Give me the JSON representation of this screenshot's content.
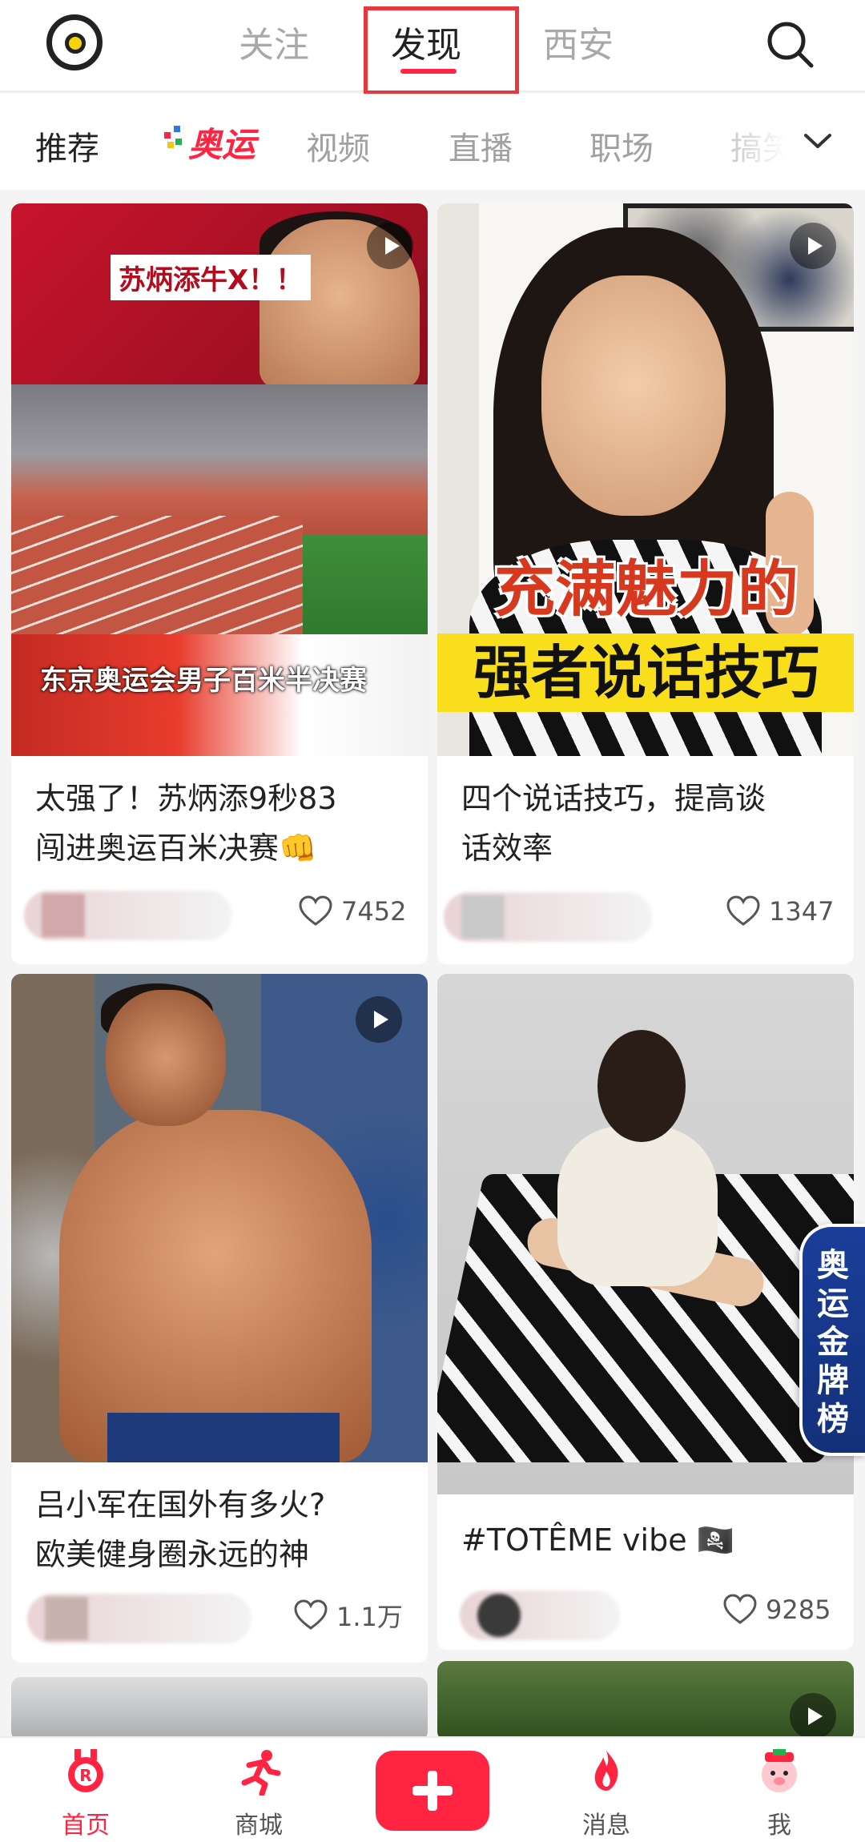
{
  "top_tabs": [
    "关注",
    "发现",
    "西安"
  ],
  "active_top_tab": "发现",
  "categories": {
    "recommend": "推荐",
    "olympic": "奥运",
    "video": "视频",
    "live": "直播",
    "workplace": "职场",
    "funny": "搞笑"
  },
  "feed": [
    {
      "title_line1": "太强了！苏炳添9秒83",
      "title_line2": "闯进奥运百米决赛👊",
      "likes": "7452",
      "thumb_banner": "苏炳添牛X！！",
      "thumb_caption": "东京奥运会男子百米半决赛",
      "is_video": true
    },
    {
      "title_line1": "四个说话技巧，提高谈",
      "title_line2": "话效率",
      "likes": "1347",
      "thumb_text1": "充满魅力的",
      "thumb_text2": "强者说话技巧",
      "is_video": true
    },
    {
      "title_line1": "吕小军在国外有多火?",
      "title_line2": "欧美健身圈永远的神",
      "likes": "1.1万",
      "is_video": true
    },
    {
      "title_line1": "#TOTÊME vibe 🏴‍☠️",
      "likes": "9285",
      "is_video": false
    }
  ],
  "side_badge": "奥运金牌榜",
  "bottom_nav": {
    "home": "首页",
    "mall": "商城",
    "messages": "消息",
    "me": "我"
  },
  "colors": {
    "accent": "#ff2442",
    "badge_blue": "#1a3e9a"
  }
}
